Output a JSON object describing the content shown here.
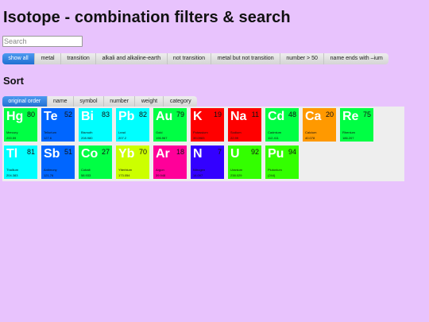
{
  "title": "Isotope - combination filters & search",
  "search": {
    "placeholder": "Search",
    "value": ""
  },
  "filters": [
    {
      "label": "show all",
      "active": true
    },
    {
      "label": "metal",
      "active": false
    },
    {
      "label": "transition",
      "active": false
    },
    {
      "label": "alkali and alkaline-earth",
      "active": false
    },
    {
      "label": "not transition",
      "active": false
    },
    {
      "label": "metal but not transition",
      "active": false
    },
    {
      "label": "number > 50",
      "active": false
    },
    {
      "label": "name ends with –ium",
      "active": false
    }
  ],
  "sort_heading": "Sort",
  "sorts": [
    {
      "label": "original order",
      "active": true
    },
    {
      "label": "name",
      "active": false
    },
    {
      "label": "symbol",
      "active": false
    },
    {
      "label": "number",
      "active": false
    },
    {
      "label": "weight",
      "active": false
    },
    {
      "label": "category",
      "active": false
    }
  ],
  "elements": [
    {
      "symbol": "Hg",
      "number": "80",
      "name": "Mercury",
      "weight": "200.59",
      "color": "#00ff44"
    },
    {
      "symbol": "Te",
      "number": "52",
      "name": "Tellurium",
      "weight": "127.6",
      "color": "#0066ff"
    },
    {
      "symbol": "Bi",
      "number": "83",
      "name": "Bismuth",
      "weight": "208.980",
      "color": "#00ffff"
    },
    {
      "symbol": "Pb",
      "number": "82",
      "name": "Lead",
      "weight": "207.2",
      "color": "#00ffff"
    },
    {
      "symbol": "Au",
      "number": "79",
      "name": "Gold",
      "weight": "196.967",
      "color": "#00ff44"
    },
    {
      "symbol": "K",
      "number": "19",
      "name": "Potassium",
      "weight": "39.0983",
      "color": "#ff0000"
    },
    {
      "symbol": "Na",
      "number": "11",
      "name": "Sodium",
      "weight": "22.99",
      "color": "#ff0000"
    },
    {
      "symbol": "Cd",
      "number": "48",
      "name": "Cadmium",
      "weight": "112.411",
      "color": "#00ff44"
    },
    {
      "symbol": "Ca",
      "number": "20",
      "name": "Calcium",
      "weight": "40.078",
      "color": "#ff9900"
    },
    {
      "symbol": "Re",
      "number": "75",
      "name": "Rhenium",
      "weight": "186.207",
      "color": "#00ff44"
    },
    {
      "symbol": "Tl",
      "number": "81",
      "name": "Thallium",
      "weight": "204.383",
      "color": "#00ffff"
    },
    {
      "symbol": "Sb",
      "number": "51",
      "name": "Antimony",
      "weight": "121.76",
      "color": "#0066ff"
    },
    {
      "symbol": "Co",
      "number": "27",
      "name": "Cobalt",
      "weight": "58.933",
      "color": "#00ff44"
    },
    {
      "symbol": "Yb",
      "number": "70",
      "name": "Ytterbium",
      "weight": "173.054",
      "color": "#ccff00"
    },
    {
      "symbol": "Ar",
      "number": "18",
      "name": "Argon",
      "weight": "39.948",
      "color": "#ff0099"
    },
    {
      "symbol": "N",
      "number": "7",
      "name": "Nitrogen",
      "weight": "14.007",
      "color": "#3300ff"
    },
    {
      "symbol": "U",
      "number": "92",
      "name": "Uranium",
      "weight": "238.029",
      "color": "#33ff00"
    },
    {
      "symbol": "Pu",
      "number": "94",
      "name": "Plutonium",
      "weight": "(244)",
      "color": "#33ff00"
    }
  ]
}
